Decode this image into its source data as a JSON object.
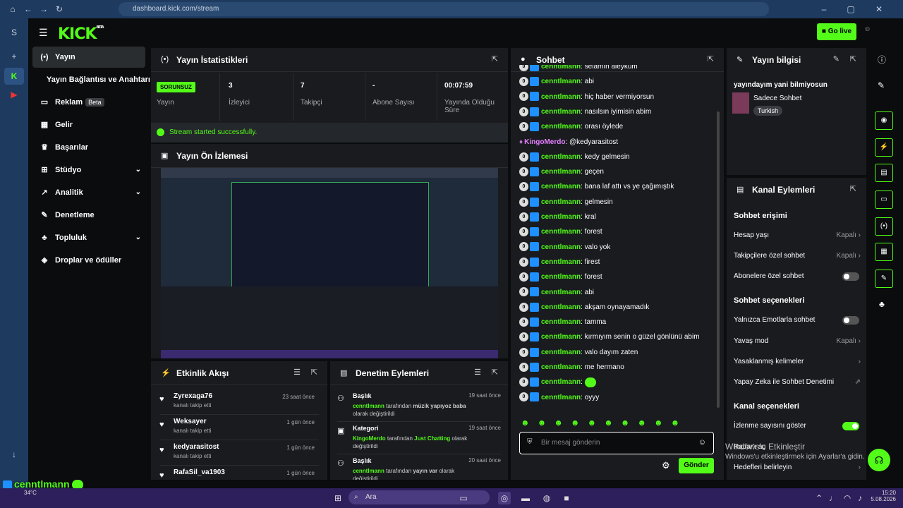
{
  "browser": {
    "url": "dashboard.kick.com/stream"
  },
  "header": {
    "logo": "KICK",
    "logo_badge": "BETA",
    "go_live": "Go live"
  },
  "nav": {
    "items": [
      {
        "label": "Yayın",
        "icon": "broadcast-icon"
      },
      {
        "label": "Yayın Bağlantısı ve Anahtarı"
      },
      {
        "label": "Reklam",
        "badge": "Beta",
        "icon": "tv-icon"
      },
      {
        "label": "Gelir",
        "icon": "chart-icon"
      },
      {
        "label": "Başarılar",
        "icon": "trophy-icon"
      },
      {
        "label": "Stüdyo",
        "icon": "studio-icon"
      },
      {
        "label": "Analitik",
        "icon": "analytics-icon"
      },
      {
        "label": "Denetleme",
        "icon": "wrench-icon"
      },
      {
        "label": "Topluluk",
        "icon": "community-icon"
      },
      {
        "label": "Droplar ve ödüller",
        "icon": "drops-icon"
      }
    ]
  },
  "stats": {
    "title": "Yayın İstatistikleri",
    "status": "SORUNSUZ",
    "status_label": "Yayın",
    "items": [
      {
        "value": "3",
        "label": "İzleyici"
      },
      {
        "value": "7",
        "label": "Takipçi"
      },
      {
        "value": "-",
        "label": "Abone Sayısı"
      },
      {
        "value": "00:07:59",
        "label": "Yayında Olduğu Süre"
      }
    ],
    "message": "Stream started successfully."
  },
  "preview": {
    "title": "Yayın Ön İzlemesi"
  },
  "events": {
    "title": "Etkinlik Akışı",
    "rows": [
      {
        "name": "Zyrexaga76",
        "sub": "kanalı takip etti",
        "time": "23 saat önce"
      },
      {
        "name": "Weksayer",
        "sub": "kanalı takip etti",
        "time": "1 gün önce"
      },
      {
        "name": "kedyarasitost",
        "sub": "kanalı takip etti",
        "time": "1 gün önce"
      },
      {
        "name": "RafaSil_va1903",
        "sub": "",
        "time": "1 gün önce"
      }
    ]
  },
  "mod": {
    "title": "Denetim Eylemleri",
    "rows": [
      {
        "title": "Başlık",
        "time": "19 saat önce",
        "user": "cenntlmann",
        "mid": " tarafından ",
        "value": "müzik yapıyoz baba",
        "end": " olarak değiştirildi"
      },
      {
        "title": "Kategori",
        "time": "19 saat önce",
        "user": "KingoMerdo",
        "mid": " tarafından ",
        "value": "Just Chatting",
        "end": " olarak değiştirildi"
      },
      {
        "title": "Başlık",
        "time": "20 saat önce",
        "user": "cenntlmann",
        "mid": " tarafından ",
        "value": "yayın var",
        "end": " olarak değiştirildi"
      }
    ]
  },
  "chat": {
    "title": "Sohbet",
    "placeholder": "Bir mesaj gönderin",
    "send": "Gönder",
    "messages": [
      {
        "user": "cenntlmann",
        "text": ": selamın aleykum"
      },
      {
        "user": "cenntlmann",
        "text": ": abi"
      },
      {
        "user": "cenntlmann",
        "text": ": hiç haber vermiyorsun"
      },
      {
        "user": "cenntlmann",
        "text": ": nasılsın iyimisin abim"
      },
      {
        "user": "cenntlmann",
        "text": ": orası öylede"
      },
      {
        "user": "KingoMerdo",
        "text": ": @kedyarasitost",
        "mod": true
      },
      {
        "user": "cenntlmann",
        "text": ": kedy gelmesin"
      },
      {
        "user": "cenntlmann",
        "text": ": geçen"
      },
      {
        "user": "cenntlmann",
        "text": ": bana laf attı vs ye çağımıştık"
      },
      {
        "user": "cenntlmann",
        "text": ": gelmesin"
      },
      {
        "user": "cenntlmann",
        "text": ": kral"
      },
      {
        "user": "cenntlmann",
        "text": ": forest"
      },
      {
        "user": "cenntlmann",
        "text": ": valo yok"
      },
      {
        "user": "cenntlmann",
        "text": ": firest"
      },
      {
        "user": "cenntlmann",
        "text": ": forest"
      },
      {
        "user": "cenntlmann",
        "text": ": abi"
      },
      {
        "user": "cenntlmann",
        "text": ": akşam oynayamadık"
      },
      {
        "user": "cenntlmann",
        "text": ": tamma"
      },
      {
        "user": "cenntlmann",
        "text": ": kırmıyım senin o güzel gönlünü abim"
      },
      {
        "user": "cenntlmann",
        "text": ": valo dayım zaten"
      },
      {
        "user": "cenntlmann",
        "text": ": me hermano"
      },
      {
        "user": "cenntlmann",
        "text": ":",
        "emote": true
      },
      {
        "user": "cenntlmann",
        "text": ": oyyy"
      }
    ]
  },
  "info": {
    "title": "Yayın bilgisi",
    "stream_title": "yayındayım yani bilmiyosun",
    "category": "Sadece Sohbet",
    "language": "Turkish"
  },
  "channel": {
    "title": "Kanal Eylemleri",
    "sec1": "Sohbet erişimi",
    "hesap": "Hesap yaşı",
    "kapali": "Kapalı",
    "takip": "Takipçilere özel sohbet",
    "abone": "Abonelere özel sohbet",
    "sec2": "Sohbet seçenekleri",
    "emote": "Yalnızca Emotlarla sohbet",
    "yavas": "Yavaş mod",
    "yasak": "Yasaklanmış kelimeler",
    "yapay": "Yapay Zeka ile Sohbet Denetimi",
    "sec3": "Kanal seçenekleri",
    "izlenme": "İzlenme sayısını göster",
    "radar": "Radar'ı aç",
    "hedef": "Hedefleri belirleyin"
  },
  "overlay": {
    "line1": "cenntlmann",
    "line2_user": "cenntlmann",
    "line2_text": "oyyy"
  },
  "watermark": {
    "title": "Windows'u Etkinleştir",
    "sub": "Windows'u etkinleştirmek için Ayarlar'a gidin."
  },
  "taskbar": {
    "search": "Ara",
    "time": "15:20",
    "date": "5.08.2026",
    "temp": "34°C"
  }
}
